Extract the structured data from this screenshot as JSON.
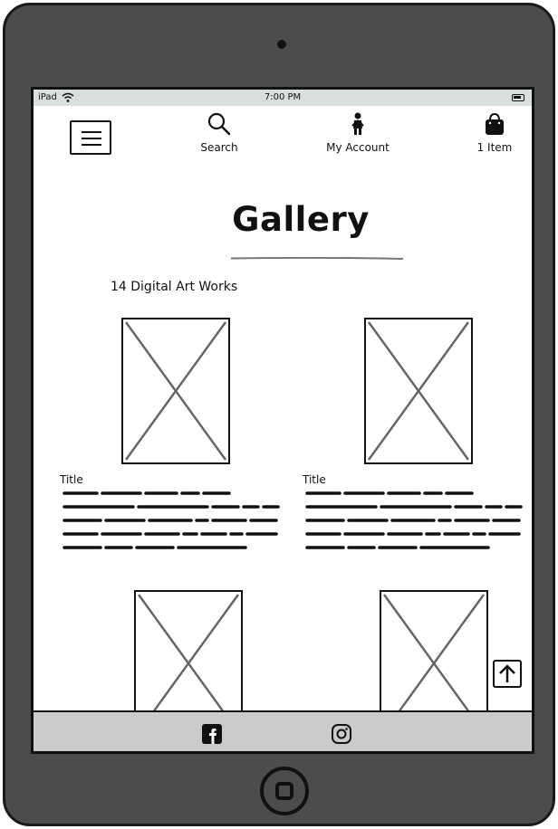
{
  "status_bar": {
    "carrier": "iPad",
    "time": "7:00 PM"
  },
  "nav": {
    "menu_icon": "hamburger-menu-icon",
    "search_label": "Search",
    "account_label": "My Account",
    "bag_label": "1 Item"
  },
  "page": {
    "title": "Gallery",
    "count_text": "14 Digital Art Works"
  },
  "items": [
    {
      "title": "Title"
    },
    {
      "title": "Title"
    }
  ],
  "footer": {
    "icons": [
      "facebook-icon",
      "instagram-icon"
    ]
  },
  "colors": {
    "frame": "#4c4c4c",
    "status_bar": "#d9dedf",
    "footer": "#cbcbcb",
    "placeholder_cross": "#666666"
  }
}
